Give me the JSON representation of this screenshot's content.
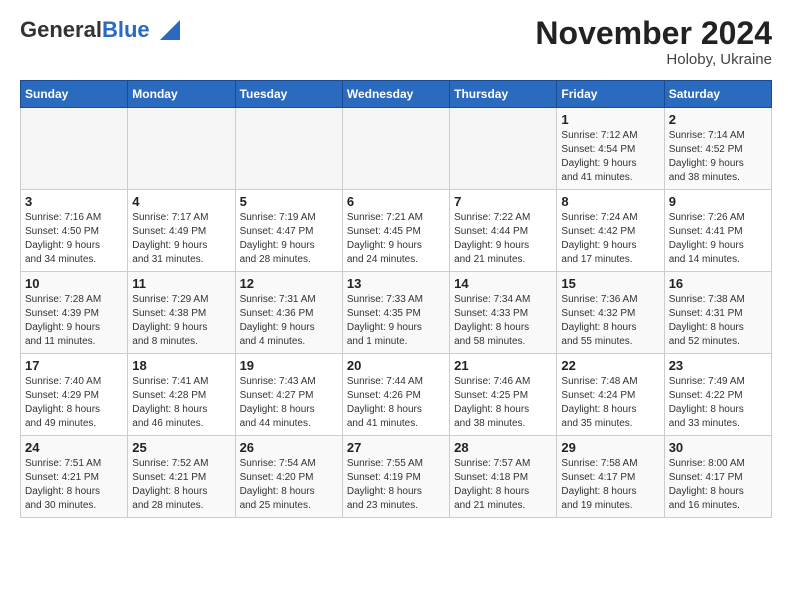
{
  "logo": {
    "general": "General",
    "blue": "Blue"
  },
  "header": {
    "month_year": "November 2024",
    "location": "Holoby, Ukraine"
  },
  "days_of_week": [
    "Sunday",
    "Monday",
    "Tuesday",
    "Wednesday",
    "Thursday",
    "Friday",
    "Saturday"
  ],
  "weeks": [
    [
      {
        "day": "",
        "info": ""
      },
      {
        "day": "",
        "info": ""
      },
      {
        "day": "",
        "info": ""
      },
      {
        "day": "",
        "info": ""
      },
      {
        "day": "",
        "info": ""
      },
      {
        "day": "1",
        "info": "Sunrise: 7:12 AM\nSunset: 4:54 PM\nDaylight: 9 hours\nand 41 minutes."
      },
      {
        "day": "2",
        "info": "Sunrise: 7:14 AM\nSunset: 4:52 PM\nDaylight: 9 hours\nand 38 minutes."
      }
    ],
    [
      {
        "day": "3",
        "info": "Sunrise: 7:16 AM\nSunset: 4:50 PM\nDaylight: 9 hours\nand 34 minutes."
      },
      {
        "day": "4",
        "info": "Sunrise: 7:17 AM\nSunset: 4:49 PM\nDaylight: 9 hours\nand 31 minutes."
      },
      {
        "day": "5",
        "info": "Sunrise: 7:19 AM\nSunset: 4:47 PM\nDaylight: 9 hours\nand 28 minutes."
      },
      {
        "day": "6",
        "info": "Sunrise: 7:21 AM\nSunset: 4:45 PM\nDaylight: 9 hours\nand 24 minutes."
      },
      {
        "day": "7",
        "info": "Sunrise: 7:22 AM\nSunset: 4:44 PM\nDaylight: 9 hours\nand 21 minutes."
      },
      {
        "day": "8",
        "info": "Sunrise: 7:24 AM\nSunset: 4:42 PM\nDaylight: 9 hours\nand 17 minutes."
      },
      {
        "day": "9",
        "info": "Sunrise: 7:26 AM\nSunset: 4:41 PM\nDaylight: 9 hours\nand 14 minutes."
      }
    ],
    [
      {
        "day": "10",
        "info": "Sunrise: 7:28 AM\nSunset: 4:39 PM\nDaylight: 9 hours\nand 11 minutes."
      },
      {
        "day": "11",
        "info": "Sunrise: 7:29 AM\nSunset: 4:38 PM\nDaylight: 9 hours\nand 8 minutes."
      },
      {
        "day": "12",
        "info": "Sunrise: 7:31 AM\nSunset: 4:36 PM\nDaylight: 9 hours\nand 4 minutes."
      },
      {
        "day": "13",
        "info": "Sunrise: 7:33 AM\nSunset: 4:35 PM\nDaylight: 9 hours\nand 1 minute."
      },
      {
        "day": "14",
        "info": "Sunrise: 7:34 AM\nSunset: 4:33 PM\nDaylight: 8 hours\nand 58 minutes."
      },
      {
        "day": "15",
        "info": "Sunrise: 7:36 AM\nSunset: 4:32 PM\nDaylight: 8 hours\nand 55 minutes."
      },
      {
        "day": "16",
        "info": "Sunrise: 7:38 AM\nSunset: 4:31 PM\nDaylight: 8 hours\nand 52 minutes."
      }
    ],
    [
      {
        "day": "17",
        "info": "Sunrise: 7:40 AM\nSunset: 4:29 PM\nDaylight: 8 hours\nand 49 minutes."
      },
      {
        "day": "18",
        "info": "Sunrise: 7:41 AM\nSunset: 4:28 PM\nDaylight: 8 hours\nand 46 minutes."
      },
      {
        "day": "19",
        "info": "Sunrise: 7:43 AM\nSunset: 4:27 PM\nDaylight: 8 hours\nand 44 minutes."
      },
      {
        "day": "20",
        "info": "Sunrise: 7:44 AM\nSunset: 4:26 PM\nDaylight: 8 hours\nand 41 minutes."
      },
      {
        "day": "21",
        "info": "Sunrise: 7:46 AM\nSunset: 4:25 PM\nDaylight: 8 hours\nand 38 minutes."
      },
      {
        "day": "22",
        "info": "Sunrise: 7:48 AM\nSunset: 4:24 PM\nDaylight: 8 hours\nand 35 minutes."
      },
      {
        "day": "23",
        "info": "Sunrise: 7:49 AM\nSunset: 4:22 PM\nDaylight: 8 hours\nand 33 minutes."
      }
    ],
    [
      {
        "day": "24",
        "info": "Sunrise: 7:51 AM\nSunset: 4:21 PM\nDaylight: 8 hours\nand 30 minutes."
      },
      {
        "day": "25",
        "info": "Sunrise: 7:52 AM\nSunset: 4:21 PM\nDaylight: 8 hours\nand 28 minutes."
      },
      {
        "day": "26",
        "info": "Sunrise: 7:54 AM\nSunset: 4:20 PM\nDaylight: 8 hours\nand 25 minutes."
      },
      {
        "day": "27",
        "info": "Sunrise: 7:55 AM\nSunset: 4:19 PM\nDaylight: 8 hours\nand 23 minutes."
      },
      {
        "day": "28",
        "info": "Sunrise: 7:57 AM\nSunset: 4:18 PM\nDaylight: 8 hours\nand 21 minutes."
      },
      {
        "day": "29",
        "info": "Sunrise: 7:58 AM\nSunset: 4:17 PM\nDaylight: 8 hours\nand 19 minutes."
      },
      {
        "day": "30",
        "info": "Sunrise: 8:00 AM\nSunset: 4:17 PM\nDaylight: 8 hours\nand 16 minutes."
      }
    ]
  ]
}
